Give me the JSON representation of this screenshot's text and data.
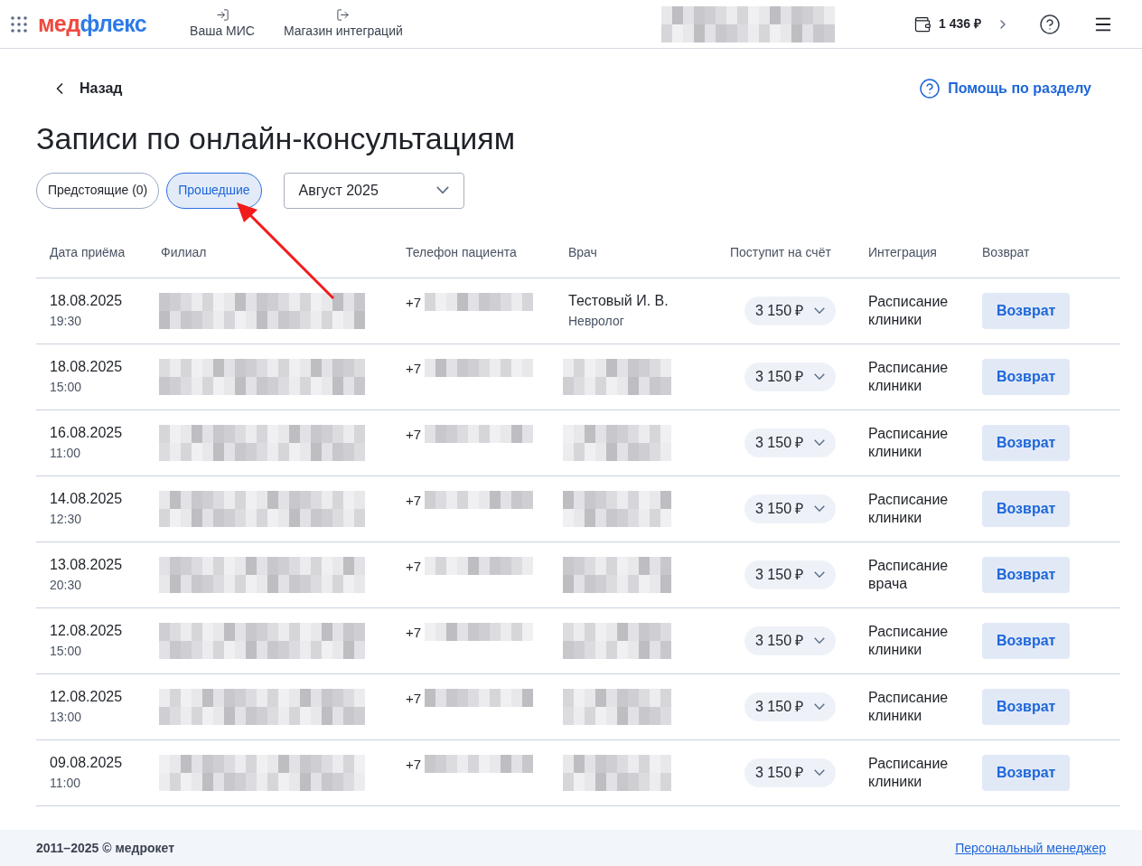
{
  "header": {
    "logo": [
      "мед",
      "флекс"
    ],
    "nav": [
      {
        "label": "Ваша МИС"
      },
      {
        "label": "Магазин интеграций"
      }
    ],
    "balance": "1 436 ₽"
  },
  "back": "Назад",
  "help": "Помощь по разделу",
  "title": "Записи по онлайн-консультациям",
  "filters": [
    {
      "label": "Предстоящие (0)",
      "selected": false
    },
    {
      "label": "Прошедшие",
      "selected": true
    }
  ],
  "month": "Август 2025",
  "table": {
    "columns": [
      "Дата приёма",
      "Филиал",
      "Телефон пациента",
      "Врач",
      "Поступит на счёт",
      "Интеграция",
      "Возврат"
    ],
    "rows": [
      {
        "date": "18.08.2025",
        "time": "19:30",
        "phone_prefix": "+7",
        "doctor": {
          "name": "Тестовый И. В.",
          "specialty": "Невролог"
        },
        "amount": "3 150 ₽",
        "integration": "Расписание клиники",
        "action": "Возврат"
      },
      {
        "date": "18.08.2025",
        "time": "15:00",
        "phone_prefix": "+7",
        "amount": "3 150 ₽",
        "integration": "Расписание клиники",
        "action": "Возврат"
      },
      {
        "date": "16.08.2025",
        "time": "11:00",
        "phone_prefix": "+7",
        "amount": "3 150 ₽",
        "integration": "Расписание клиники",
        "action": "Возврат"
      },
      {
        "date": "14.08.2025",
        "time": "12:30",
        "phone_prefix": "+7",
        "amount": "3 150 ₽",
        "integration": "Расписание клиники",
        "action": "Возврат"
      },
      {
        "date": "13.08.2025",
        "time": "20:30",
        "phone_prefix": "+7",
        "amount": "3 150 ₽",
        "integration": "Расписание врача",
        "action": "Возврат"
      },
      {
        "date": "12.08.2025",
        "time": "15:00",
        "phone_prefix": "+7",
        "amount": "3 150 ₽",
        "integration": "Расписание клиники",
        "action": "Возврат"
      },
      {
        "date": "12.08.2025",
        "time": "13:00",
        "phone_prefix": "+7",
        "amount": "3 150 ₽",
        "integration": "Расписание клиники",
        "action": "Возврат"
      },
      {
        "date": "09.08.2025",
        "time": "11:00",
        "phone_prefix": "+7",
        "amount": "3 150 ₽",
        "integration": "Расписание клиники",
        "action": "Возврат"
      }
    ]
  },
  "footer": {
    "copyright": "2011–2025 © медрокет",
    "link": "Персональный менеджер"
  }
}
